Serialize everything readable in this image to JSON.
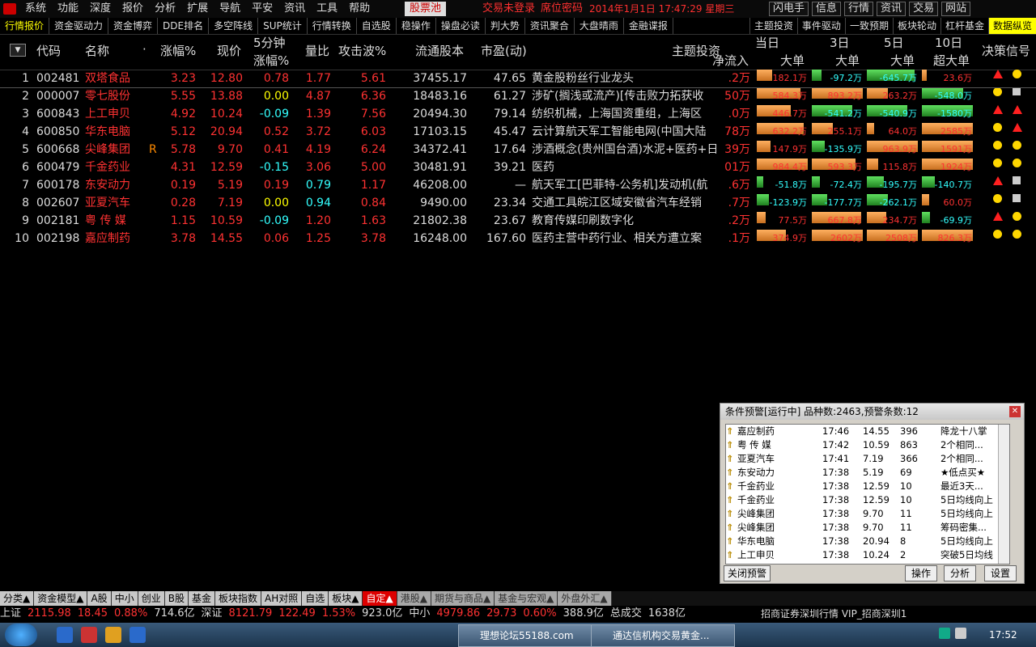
{
  "menubar": {
    "items": [
      "系统",
      "功能",
      "深度",
      "报价",
      "分析",
      "扩展",
      "导航",
      "平安",
      "资讯",
      "工具",
      "帮助"
    ],
    "stock_pool": "股票池",
    "login_status": "交易未登录",
    "seat_code": "席位密码",
    "datetime": "2014年1月1日  17:47:29  星期三",
    "buttons": [
      "闪电手",
      "信息",
      "行情",
      "资讯",
      "交易",
      "网站"
    ]
  },
  "tabbar": {
    "left": [
      "行情报价",
      "资金驱动力",
      "资金博弈",
      "DDE排名",
      "多空阵线",
      "SUP统计",
      "行情转换",
      "自选股",
      "稳操作",
      "操盘必读",
      "判大势",
      "资讯聚合",
      "大盘晴雨",
      "金融谍报"
    ],
    "right": [
      "主题投资",
      "事件驱动",
      "一致预期",
      "板块轮动",
      "杠杆基金",
      "数据纵览"
    ]
  },
  "headers": {
    "code": "代码",
    "name": "名称",
    "dot": "·",
    "pct": "涨幅%",
    "price": "现价",
    "five_min_1": "5分钟",
    "five_min_2": "涨幅%",
    "vol_ratio": "量比",
    "attack": "攻击波%",
    "float_cap": "流通股本",
    "pe": "市盈(动)",
    "theme": "主题投资",
    "day1": "当日",
    "day3": "3日",
    "day5": "5日",
    "day10": "10日",
    "net": "净流入",
    "big": "大单",
    "super": "超大单",
    "signal": "决策信号"
  },
  "rows": [
    {
      "n": "1",
      "code": "002481",
      "name": "双塔食品",
      "flag": "",
      "pct": "3.23",
      "price": "12.80",
      "m5": "0.78",
      "m5c": "red",
      "vr": "1.77",
      "vrc": "red",
      "atk": "5.61",
      "cap": "37455.17",
      "pe": "47.65",
      "theme": "黄金股粉丝行业龙头",
      "net": ".2万",
      "d1": "182.1万",
      "d3": "-97.2万",
      "d5": "-645.7万",
      "d10": "23.6万",
      "s1": "tri",
      "s2": "dot"
    },
    {
      "n": "2",
      "code": "000007",
      "name": "零七股份",
      "flag": "",
      "pct": "5.55",
      "price": "13.88",
      "m5": "0.00",
      "m5c": "yel",
      "vr": "4.87",
      "vrc": "red",
      "atk": "6.36",
      "cap": "18483.16",
      "pe": "61.27",
      "theme": "涉矿(搁浅或流产)[传击败力拓获收",
      "net": "50万",
      "d1": "584.3万",
      "d3": "893.2万",
      "d5": "263.2万",
      "d10": "-548.0万",
      "s1": "dot",
      "s2": "sq"
    },
    {
      "n": "3",
      "code": "600843",
      "name": "上工申贝",
      "flag": "",
      "pct": "4.92",
      "price": "10.24",
      "m5": "-0.09",
      "m5c": "grn",
      "vr": "1.39",
      "vrc": "red",
      "atk": "7.56",
      "cap": "20494.30",
      "pe": "79.14",
      "theme": "纺织机械，上海国资重组，上海区",
      "net": ".0万",
      "d1": "446.7万",
      "d3": "-541.2万",
      "d5": "-540.9万",
      "d10": "-1580万",
      "s1": "tri",
      "s2": "tri"
    },
    {
      "n": "4",
      "code": "600850",
      "name": "华东电脑",
      "flag": "",
      "pct": "5.12",
      "price": "20.94",
      "m5": "0.52",
      "m5c": "red",
      "vr": "3.72",
      "vrc": "red",
      "atk": "6.03",
      "cap": "17103.15",
      "pe": "45.47",
      "theme": "云计算航天军工智能电网(中国大陆",
      "net": "78万",
      "d1": "632.2万",
      "d3": "255.1万",
      "d5": "64.0万",
      "d10": "2585万",
      "s1": "dot",
      "s2": "tri"
    },
    {
      "n": "5",
      "code": "600668",
      "name": "尖峰集团",
      "flag": "R",
      "pct": "5.78",
      "price": "9.70",
      "m5": "0.41",
      "m5c": "red",
      "vr": "4.19",
      "vrc": "red",
      "atk": "6.24",
      "cap": "34372.41",
      "pe": "17.64",
      "theme": "涉酒概念(贵州国台酒)水泥+医药+日",
      "net": "39万",
      "d1": "147.9万",
      "d3": "-135.9万",
      "d5": "963.9万",
      "d10": "1591万",
      "s1": "dot",
      "s2": "dot"
    },
    {
      "n": "6",
      "code": "600479",
      "name": "千金药业",
      "flag": "",
      "pct": "4.31",
      "price": "12.59",
      "m5": "-0.15",
      "m5c": "grn",
      "vr": "3.06",
      "vrc": "red",
      "atk": "5.00",
      "cap": "30481.91",
      "pe": "39.21",
      "theme": "医药",
      "net": "01万",
      "d1": "984.4万",
      "d3": "593.3万",
      "d5": "115.8万",
      "d10": "1924万",
      "s1": "dot",
      "s2": "dot"
    },
    {
      "n": "7",
      "code": "600178",
      "name": "东安动力",
      "flag": "",
      "pct": "0.19",
      "price": "5.19",
      "m5": "0.19",
      "m5c": "red",
      "vr": "0.79",
      "vrc": "grn",
      "atk": "1.17",
      "cap": "46208.00",
      "pe": "—",
      "theme": "航天军工[巴菲特-公务机]发动机(航",
      "net": ".6万",
      "d1": "-51.8万",
      "d3": "-72.4万",
      "d5": "-195.7万",
      "d10": "-140.7万",
      "s1": "tri",
      "s2": "sq"
    },
    {
      "n": "8",
      "code": "002607",
      "name": "亚夏汽车",
      "flag": "",
      "pct": "0.28",
      "price": "7.19",
      "m5": "0.00",
      "m5c": "yel",
      "vr": "0.94",
      "vrc": "grn",
      "atk": "0.84",
      "cap": "9490.00",
      "pe": "23.34",
      "theme": "交通工具皖江区域安徽省汽车经销",
      "net": ".7万",
      "d1": "-123.9万",
      "d3": "-177.7万",
      "d5": "-262.1万",
      "d10": "60.0万",
      "s1": "dot",
      "s2": "sq"
    },
    {
      "n": "9",
      "code": "002181",
      "name": "粤 传 媒",
      "flag": "",
      "pct": "1.15",
      "price": "10.59",
      "m5": "-0.09",
      "m5c": "grn",
      "vr": "1.20",
      "vrc": "red",
      "atk": "1.63",
      "cap": "21802.38",
      "pe": "23.67",
      "theme": "教育传媒印刷数字化",
      "net": ".2万",
      "d1": "77.5万",
      "d3": "667.8万",
      "d5": "234.7万",
      "d10": "-69.9万",
      "s1": "tri",
      "s2": "dot"
    },
    {
      "n": "10",
      "code": "002198",
      "name": "嘉应制药",
      "flag": "",
      "pct": "3.78",
      "price": "14.55",
      "m5": "0.06",
      "m5c": "red",
      "vr": "1.25",
      "vrc": "red",
      "atk": "3.78",
      "cap": "16248.00",
      "pe": "167.60",
      "theme": "医药主营中药行业、相关方遭立案",
      "net": ".1万",
      "d1": "374.9万",
      "d3": "2602万",
      "d5": "2508万",
      "d10": "826.3万",
      "s1": "dot",
      "s2": "dot"
    }
  ],
  "popup": {
    "title": "条件预警[运行中] 品种数:2463,预警条数:12",
    "rows": [
      {
        "name": "嘉应制药",
        "time": "17:46",
        "price": "14.55",
        "vol": "396",
        "msg": "降龙十八掌"
      },
      {
        "name": "粤 传 媒",
        "time": "17:42",
        "price": "10.59",
        "vol": "863",
        "msg": "2个相同..."
      },
      {
        "name": "亚夏汽车",
        "time": "17:41",
        "price": "7.19",
        "vol": "366",
        "msg": "2个相同..."
      },
      {
        "name": "东安动力",
        "time": "17:38",
        "price": "5.19",
        "vol": "69",
        "msg": "★低点买★"
      },
      {
        "name": "千金药业",
        "time": "17:38",
        "price": "12.59",
        "vol": "10",
        "msg": "最近3天..."
      },
      {
        "name": "千金药业",
        "time": "17:38",
        "price": "12.59",
        "vol": "10",
        "msg": "5日均线向上"
      },
      {
        "name": "尖峰集团",
        "time": "17:38",
        "price": "9.70",
        "vol": "11",
        "msg": "5日均线向上"
      },
      {
        "name": "尖峰集团",
        "time": "17:38",
        "price": "9.70",
        "vol": "11",
        "msg": "筹码密集..."
      },
      {
        "name": "华东电脑",
        "time": "17:38",
        "price": "20.94",
        "vol": "8",
        "msg": "5日均线向上"
      },
      {
        "name": "上工申贝",
        "time": "17:38",
        "price": "10.24",
        "vol": "2",
        "msg": "突破5日均线"
      }
    ],
    "close_alert": "关闭预警",
    "operate": "操作",
    "analyze": "分析",
    "settings": "设置"
  },
  "category_tabs": [
    "分类▲",
    "资金模型▲",
    "A股",
    "中小",
    "创业",
    "B股",
    "基金",
    "板块指数",
    "AH对照",
    "自选",
    "板块▲",
    "自定▲",
    "港股▲",
    "期货与商品▲",
    "基金与宏观▲",
    "外盘外汇▲"
  ],
  "index_bar": {
    "sh_label": "上证",
    "sh_val": "2115.98",
    "sh_chg": "18.45",
    "sh_pct": "0.88%",
    "sh_amt": "714.6亿",
    "sz_label": "深证",
    "sz_val": "8121.79",
    "sz_chg": "122.49",
    "sz_pct": "1.53%",
    "sz_amt": "923.0亿",
    "zx_label": "中小",
    "zx_val": "4979.86",
    "zx_chg": "29.73",
    "zx_pct": "0.60%",
    "zx_amt": "388.9亿",
    "total_label": "总成交",
    "total_val": "1638亿"
  },
  "status_text": "招商证券深圳行情  VIP_招商深圳1",
  "taskbar": {
    "task1": "理想论坛55188.com",
    "task2": "通达信机构交易黄金...",
    "time": "17:52"
  }
}
